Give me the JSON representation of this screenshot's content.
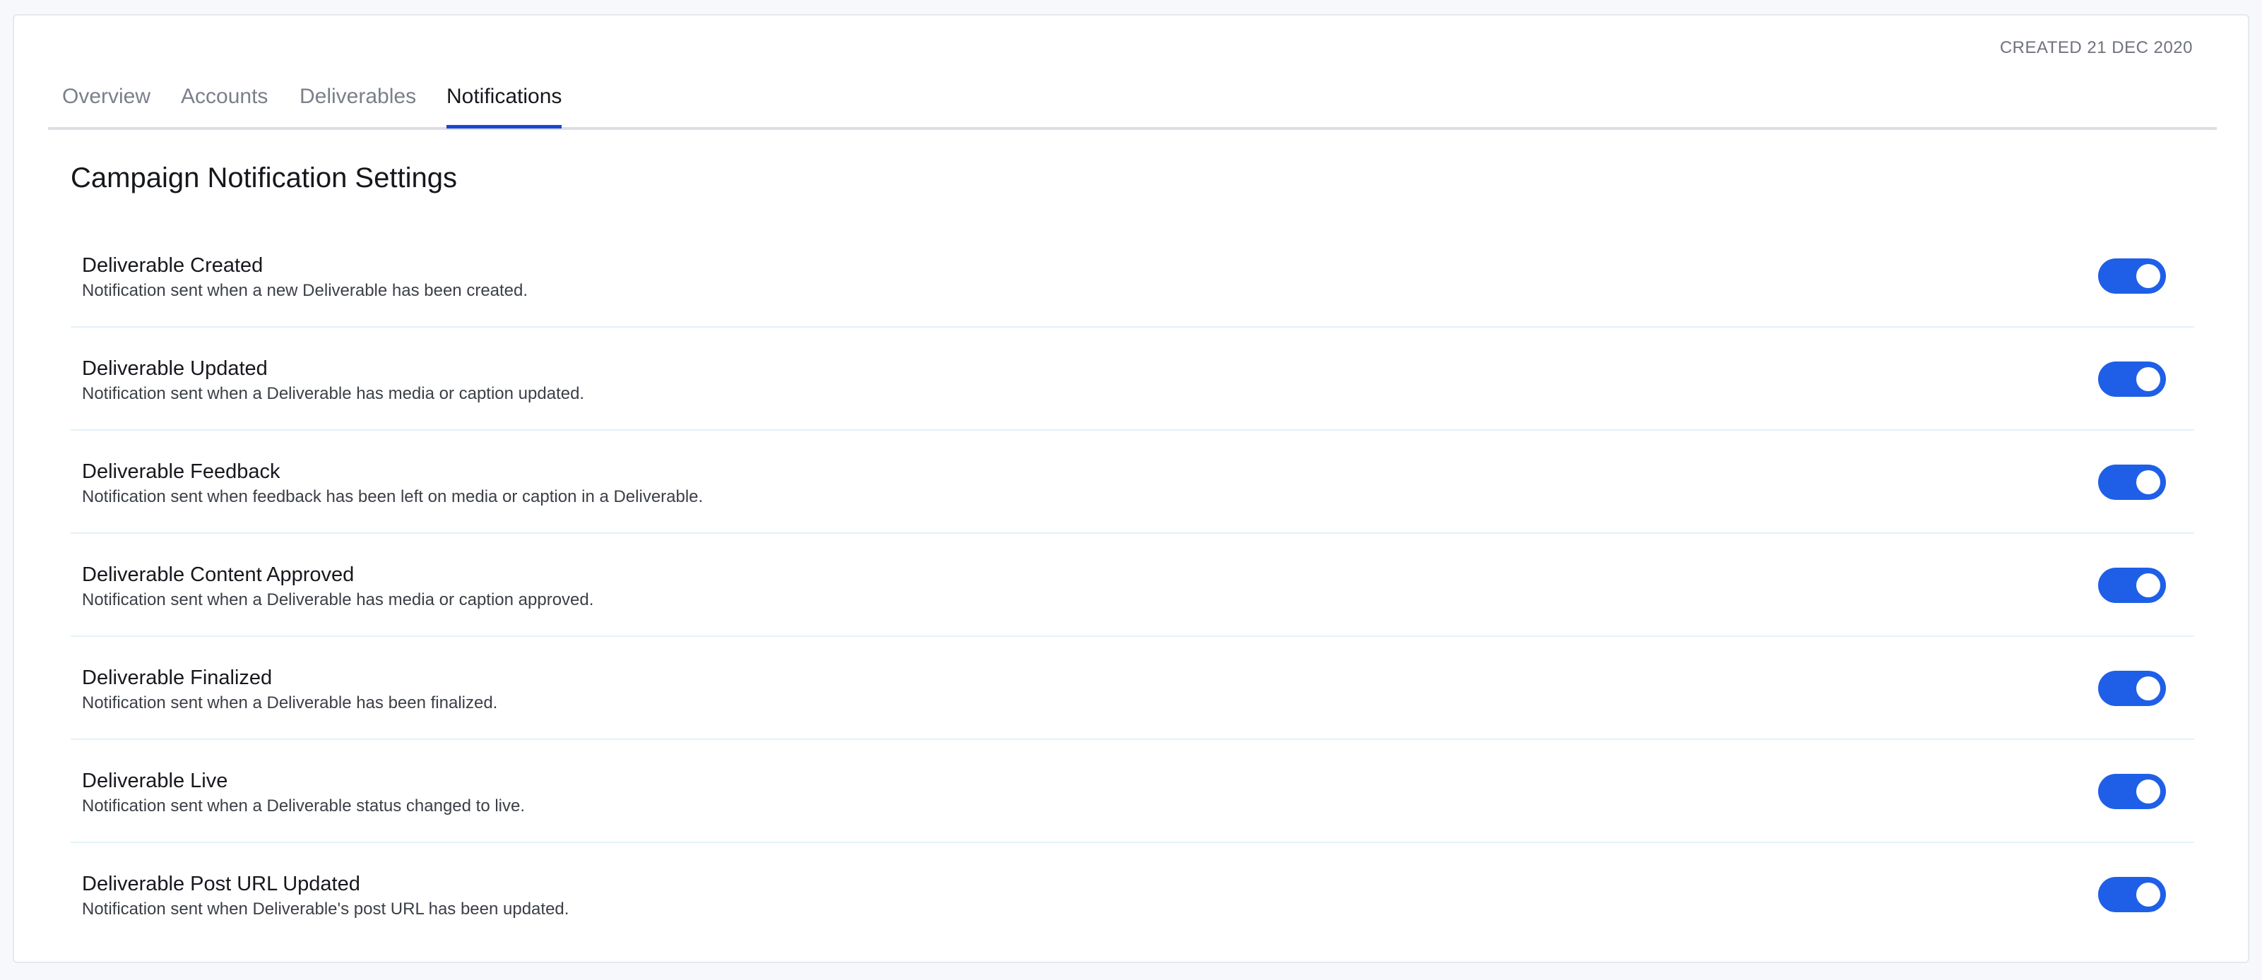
{
  "header": {
    "created_label": "CREATED 21 DEC 2020"
  },
  "tabs": [
    {
      "label": "Overview",
      "active": false
    },
    {
      "label": "Accounts",
      "active": false
    },
    {
      "label": "Deliverables",
      "active": false
    },
    {
      "label": "Notifications",
      "active": true
    }
  ],
  "section": {
    "title": "Campaign Notification Settings"
  },
  "notifications": [
    {
      "title": "Deliverable Created",
      "description": "Notification sent when a new Deliverable has been created.",
      "enabled": true
    },
    {
      "title": "Deliverable Updated",
      "description": "Notification sent when a Deliverable has media or caption updated.",
      "enabled": true
    },
    {
      "title": "Deliverable Feedback",
      "description": "Notification sent when feedback has been left on media or caption in a Deliverable.",
      "enabled": true
    },
    {
      "title": "Deliverable Content Approved",
      "description": "Notification sent when a Deliverable has media or caption approved.",
      "enabled": true
    },
    {
      "title": "Deliverable Finalized",
      "description": "Notification sent when a Deliverable has been finalized.",
      "enabled": true
    },
    {
      "title": "Deliverable Live",
      "description": "Notification sent when a Deliverable status changed to live.",
      "enabled": true
    },
    {
      "title": "Deliverable Post URL Updated",
      "description": "Notification sent when Deliverable's post URL has been updated.",
      "enabled": true
    }
  ],
  "colors": {
    "accent": "#1a46d3",
    "toggle_on": "#1f5fe8",
    "divider": "#e3f2f8"
  }
}
